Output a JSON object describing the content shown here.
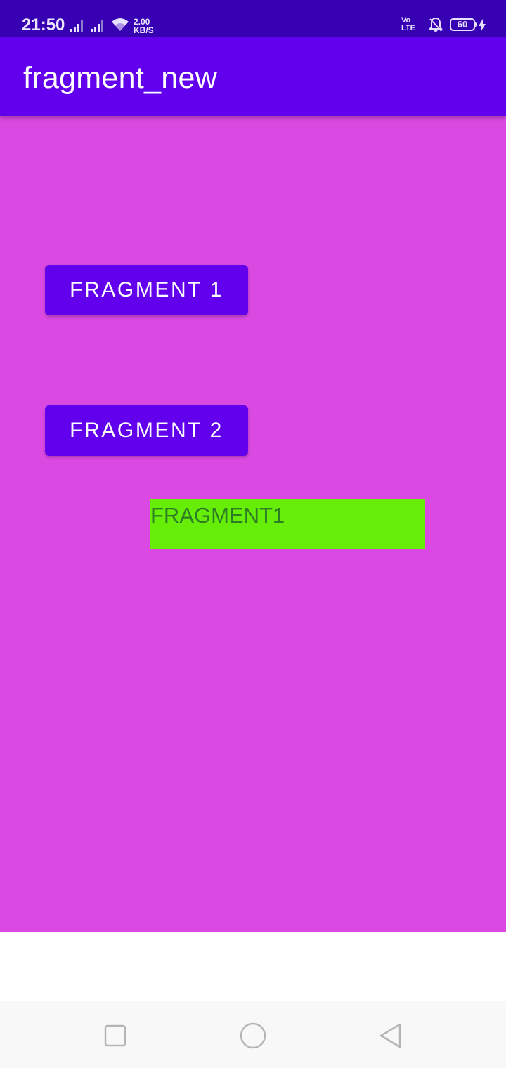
{
  "status_bar": {
    "time": "21:50",
    "net_speed_value": "2.00",
    "net_speed_unit": "KB/S",
    "volte_top": "Vo",
    "volte_bottom": "LTE",
    "battery": "60"
  },
  "app_bar": {
    "title": "fragment_new"
  },
  "main": {
    "button_1_label": "FRAGMENT 1",
    "button_2_label": "FRAGMENT 2",
    "fragment_text": "FRAGMENT1"
  },
  "nav_bar": {
    "icons": [
      "recents-icon",
      "home-icon",
      "back-icon"
    ]
  },
  "colors": {
    "status_bar": "#3700b3",
    "app_bar": "#6200ee",
    "content_background": "#da4ae3",
    "button": "#6200ee",
    "fragment_background": "#66ee09",
    "fragment_text": "#2e7d24"
  }
}
